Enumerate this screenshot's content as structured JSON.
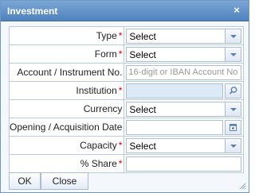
{
  "dialog": {
    "title": "Investment",
    "close_glyph": "×"
  },
  "fields": {
    "type": {
      "label": "Type",
      "required": "*",
      "value": "Select"
    },
    "form": {
      "label": "Form",
      "required": "*",
      "value": "Select"
    },
    "account": {
      "label": "Account / Instrument No.",
      "placeholder": "16-digit or IBAN Account No"
    },
    "institution": {
      "label": "Institution",
      "required": "*",
      "value": ""
    },
    "currency": {
      "label": "Currency",
      "value": "Select"
    },
    "opening_date": {
      "label": "Opening / Acquisition Date",
      "value": ""
    },
    "capacity": {
      "label": "Capacity",
      "required": "*",
      "value": "Select"
    },
    "share": {
      "label": "% Share",
      "required": "*",
      "value": ""
    }
  },
  "buttons": {
    "ok": "OK",
    "close": "Close"
  },
  "icons": {
    "dropdown": "chevron-down-icon",
    "search": "search-icon",
    "calendar": "calendar-icon",
    "close": "close-icon",
    "resize": "resize-grip-icon"
  },
  "colors": {
    "titlebar": "#4f82bd",
    "required": "#cc0000",
    "field_highlight": "#dce9f7"
  }
}
